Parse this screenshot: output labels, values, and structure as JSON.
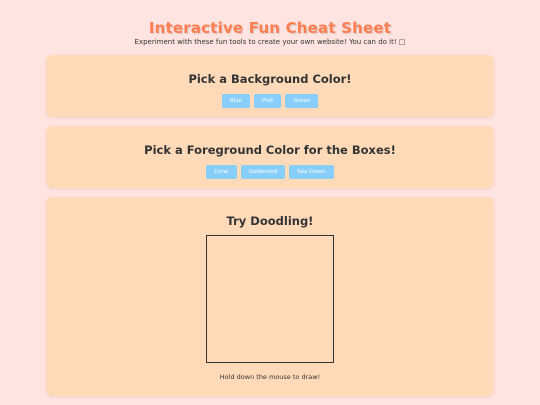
{
  "page": {
    "title": "Interactive Fun Cheat Sheet",
    "subtitle": "Experiment with these fun tools to create your own website! You can do it! □"
  },
  "background_section": {
    "heading": "Pick a Background Color!",
    "buttons": [
      {
        "label": "Blue"
      },
      {
        "label": "Pink"
      },
      {
        "label": "Green"
      }
    ]
  },
  "foreground_section": {
    "heading": "Pick a Foreground Color for the Boxes!",
    "buttons": [
      {
        "label": "Coral"
      },
      {
        "label": "Goldenrod"
      },
      {
        "label": "Sea Green"
      }
    ]
  },
  "doodle_section": {
    "heading": "Try Doodling!",
    "hint": "Hold down the mouse to draw!"
  },
  "colors": {
    "page_background": "#ffe4e1",
    "card_background": "#ffdab9",
    "title": "#ff7f50",
    "button": "#87cefa",
    "text": "#333333"
  }
}
